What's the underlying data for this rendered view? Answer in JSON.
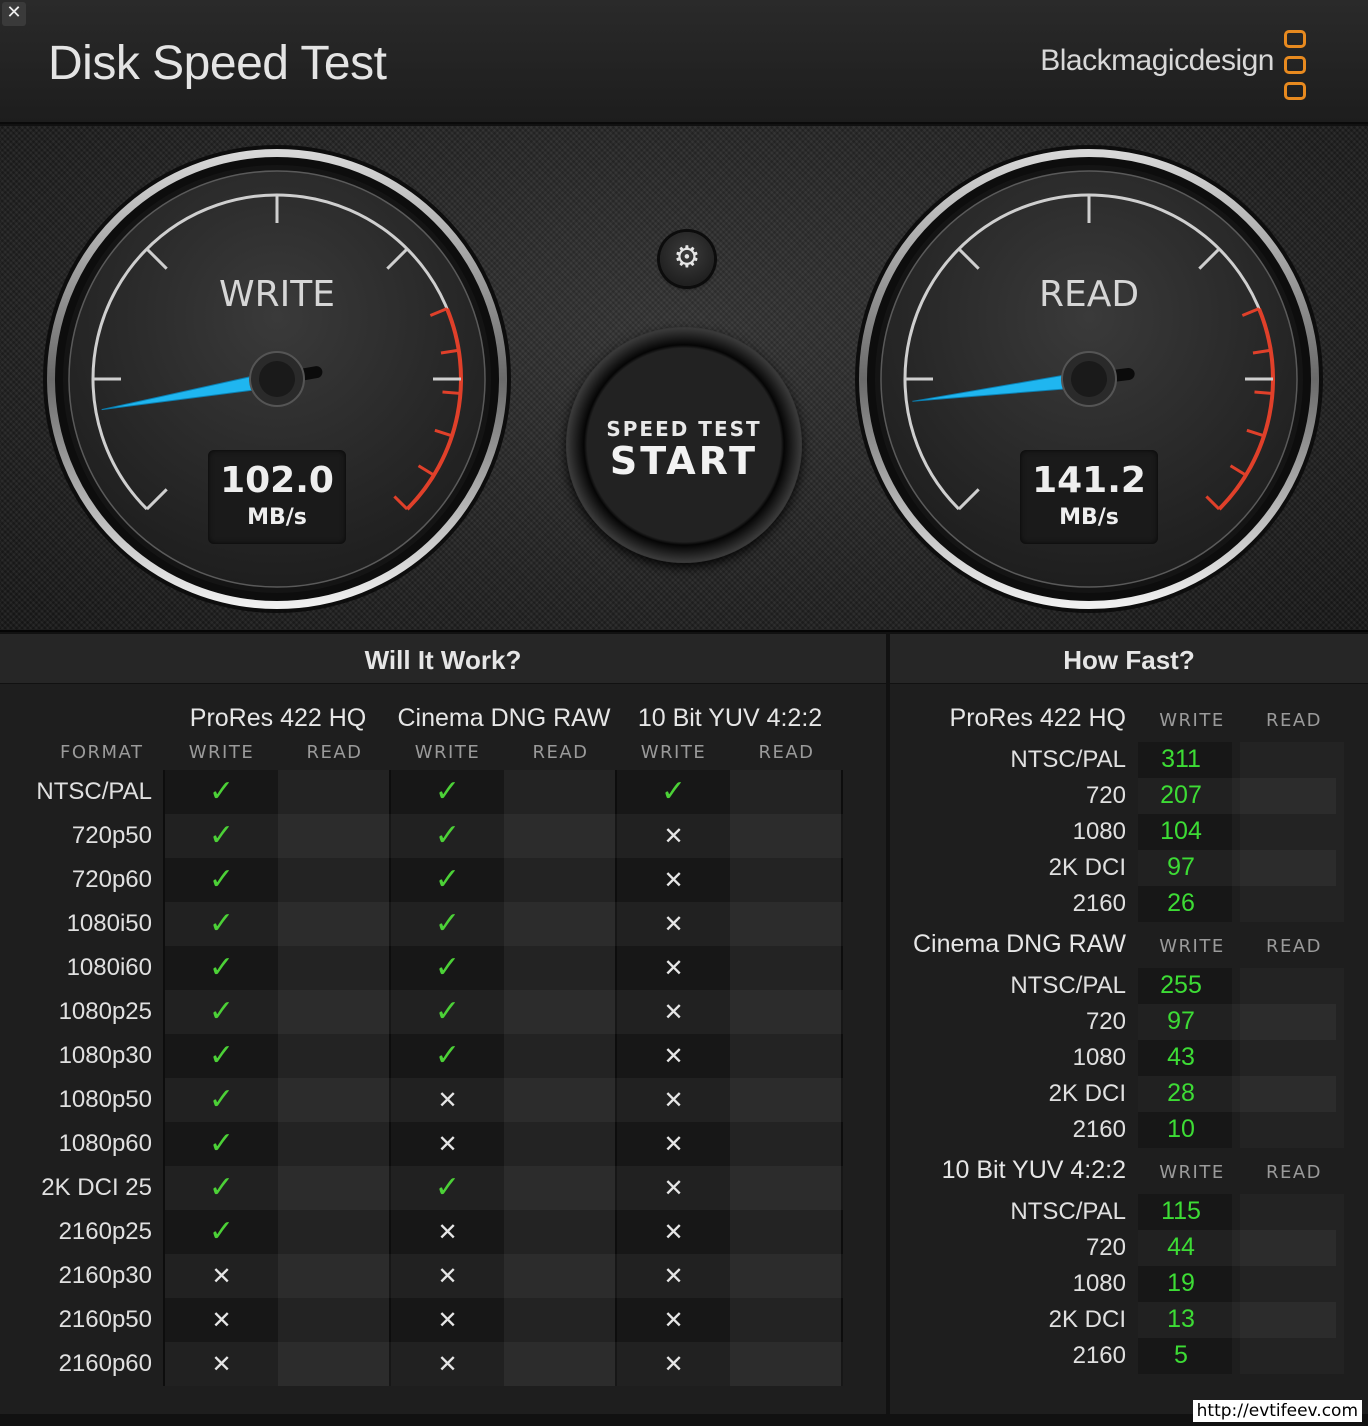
{
  "window": {
    "close_glyph": "✕",
    "title": "Disk Speed Test",
    "brand": "Blackmagicdesign"
  },
  "gauges": {
    "write": {
      "label": "WRITE",
      "value": "102.0",
      "unit": "MB/s",
      "needle_fraction": 0.13
    },
    "read": {
      "label": "READ",
      "value": "141.2",
      "unit": "MB/s",
      "needle_fraction": 0.14
    }
  },
  "controls": {
    "settings_icon": "gear-icon",
    "start_sub": "SPEED TEST",
    "start_main": "START"
  },
  "will_it_work": {
    "header": "Will It Work?",
    "format_header": "FORMAT",
    "write_header": "WRITE",
    "read_header": "READ",
    "codecs": [
      "ProRes 422 HQ",
      "Cinema DNG RAW",
      "10 Bit YUV 4:2:2"
    ],
    "rows": [
      {
        "format": "NTSC/PAL",
        "prores": true,
        "dng": true,
        "yuv": true
      },
      {
        "format": "720p50",
        "prores": true,
        "dng": true,
        "yuv": false
      },
      {
        "format": "720p60",
        "prores": true,
        "dng": true,
        "yuv": false
      },
      {
        "format": "1080i50",
        "prores": true,
        "dng": true,
        "yuv": false
      },
      {
        "format": "1080i60",
        "prores": true,
        "dng": true,
        "yuv": false
      },
      {
        "format": "1080p25",
        "prores": true,
        "dng": true,
        "yuv": false
      },
      {
        "format": "1080p30",
        "prores": true,
        "dng": true,
        "yuv": false
      },
      {
        "format": "1080p50",
        "prores": true,
        "dng": false,
        "yuv": false
      },
      {
        "format": "1080p60",
        "prores": true,
        "dng": false,
        "yuv": false
      },
      {
        "format": "2K DCI 25",
        "prores": true,
        "dng": true,
        "yuv": false
      },
      {
        "format": "2160p25",
        "prores": true,
        "dng": false,
        "yuv": false
      },
      {
        "format": "2160p30",
        "prores": false,
        "dng": false,
        "yuv": false
      },
      {
        "format": "2160p50",
        "prores": false,
        "dng": false,
        "yuv": false
      },
      {
        "format": "2160p60",
        "prores": false,
        "dng": false,
        "yuv": false
      }
    ],
    "check_glyph": "✓",
    "cross_glyph": "✕"
  },
  "how_fast": {
    "header": "How Fast?",
    "write_header": "WRITE",
    "read_header": "READ",
    "groups": [
      {
        "codec": "ProRes 422 HQ",
        "rows": [
          {
            "format": "NTSC/PAL",
            "write": "311"
          },
          {
            "format": "720",
            "write": "207"
          },
          {
            "format": "1080",
            "write": "104"
          },
          {
            "format": "2K DCI",
            "write": "97"
          },
          {
            "format": "2160",
            "write": "26"
          }
        ]
      },
      {
        "codec": "Cinema DNG RAW",
        "rows": [
          {
            "format": "NTSC/PAL",
            "write": "255"
          },
          {
            "format": "720",
            "write": "97"
          },
          {
            "format": "1080",
            "write": "43"
          },
          {
            "format": "2K DCI",
            "write": "28"
          },
          {
            "format": "2160",
            "write": "10"
          }
        ]
      },
      {
        "codec": "10 Bit YUV 4:2:2",
        "rows": [
          {
            "format": "NTSC/PAL",
            "write": "115"
          },
          {
            "format": "720",
            "write": "44"
          },
          {
            "format": "1080",
            "write": "19"
          },
          {
            "format": "2K DCI",
            "write": "13"
          },
          {
            "format": "2160",
            "write": "5"
          }
        ]
      }
    ]
  },
  "watermark": "http://evtifeev.com",
  "colors": {
    "accent_needle": "#1fb6f0",
    "redline": "#e0402a",
    "ok_green": "#4cd137",
    "speed_green": "#3ddc35",
    "logo_orange": "#e88a1f"
  }
}
